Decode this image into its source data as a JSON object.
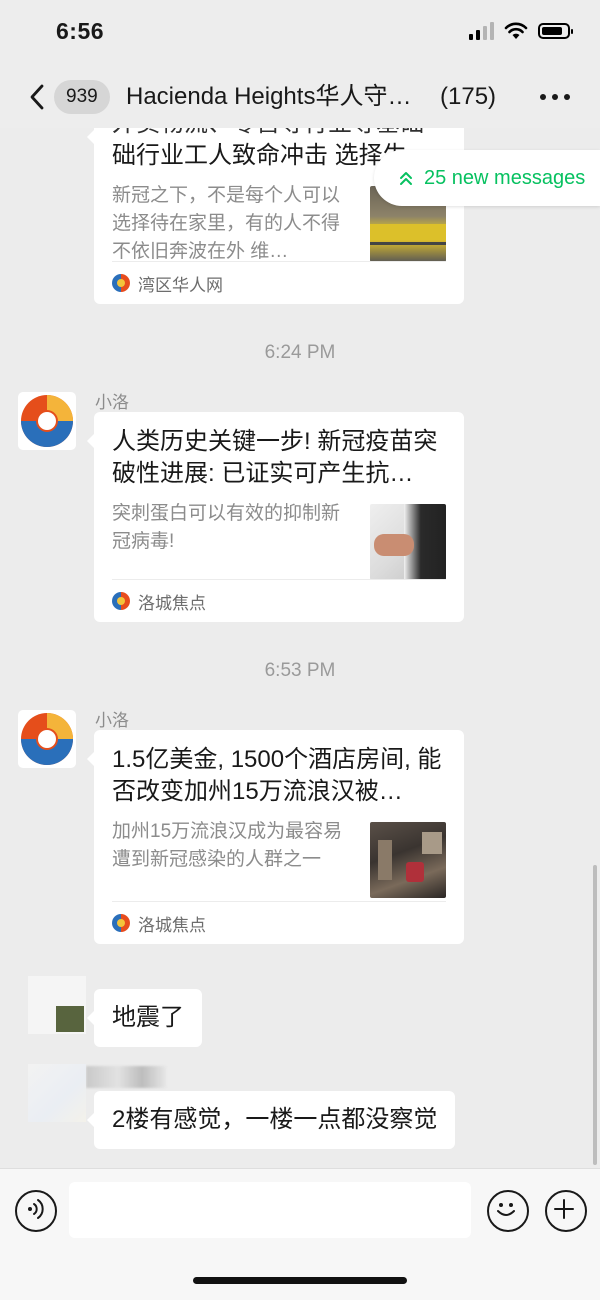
{
  "status_bar": {
    "time": "6:56"
  },
  "nav": {
    "unread_count": "939",
    "title": "Hacienda Heights华人守…",
    "member_count": "(175)"
  },
  "new_messages": {
    "label": "25 new messages"
  },
  "messages": [
    {
      "type": "article",
      "title": "外卖物流、零售等行业等基础行业工人致命冲击 选择生",
      "title_visible": "础行业工人致命冲击 选择生",
      "description": "新冠之下，不是每个人可以选择待在家里，有的人不得不依旧奔波在外 维…",
      "source": "湾区华人网"
    },
    {
      "type": "time",
      "text": "6:24 PM"
    },
    {
      "type": "article",
      "sender": "小洛",
      "title": "人类历史关键一步! 新冠疫苗突破性进展: 已证实可产生抗…",
      "description": "突刺蛋白可以有效的抑制新冠病毒!",
      "source": "洛城焦点"
    },
    {
      "type": "time",
      "text": "6:53 PM"
    },
    {
      "type": "article",
      "sender": "小洛",
      "title": "1.5亿美金, 1500个酒店房间, 能否改变加州15万流浪汉被…",
      "description": "加州15万流浪汉成为最容易遭到新冠感染的人群之一",
      "source": "洛城焦点"
    },
    {
      "type": "text",
      "text": "地震了"
    },
    {
      "type": "text",
      "text": "2楼有感觉，一楼一点都没察觉"
    }
  ],
  "input": {
    "placeholder": ""
  },
  "icons": {
    "back": "chevron-left-icon",
    "more": "more-dots-icon",
    "voice": "voice-icon",
    "emoji": "emoji-icon",
    "plus": "plus-icon",
    "new_messages": "double-chevron-up-icon"
  },
  "colors": {
    "accent": "#07c160",
    "background": "#ececec",
    "bubble": "#ffffff"
  }
}
